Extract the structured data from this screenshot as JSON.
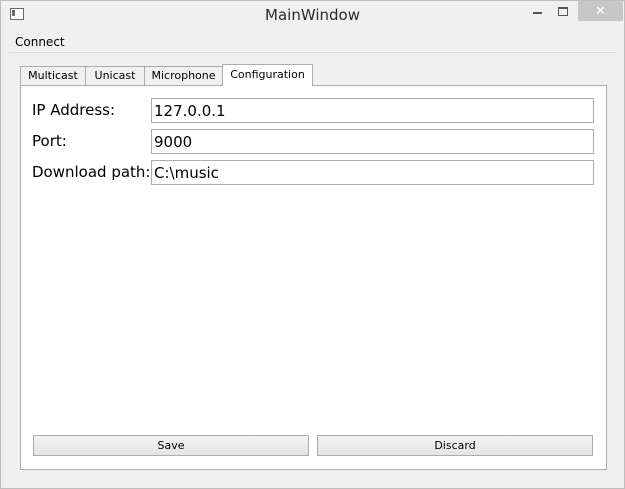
{
  "window": {
    "title": "MainWindow",
    "close_symbol": "✕"
  },
  "menubar": {
    "items": [
      {
        "label": "Connect"
      }
    ]
  },
  "tabs": [
    {
      "label": "Multicast",
      "active": false
    },
    {
      "label": "Unicast",
      "active": false
    },
    {
      "label": "Microphone",
      "active": false
    },
    {
      "label": "Configuration",
      "active": true
    }
  ],
  "config": {
    "ip_label": "IP Address:",
    "ip_value": "127.0.0.1",
    "port_label": "Port:",
    "port_value": "9000",
    "download_label": "Download path:",
    "download_value": "C:\\music"
  },
  "buttons": {
    "save_label": "Save",
    "discard_label": "Discard"
  },
  "colors": {
    "close_button_bg": "#c7c7c7",
    "panel_bg": "#ffffff",
    "window_bg": "#f0f0f0"
  },
  "icons": {
    "app": "app-window-icon",
    "minimize": "minimize-icon",
    "maximize": "maximize-icon",
    "close": "close-icon"
  }
}
